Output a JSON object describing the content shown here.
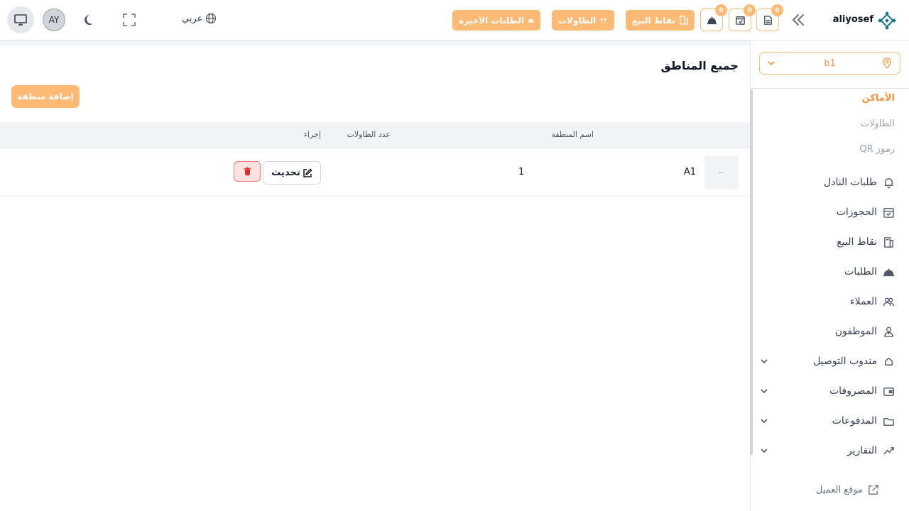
{
  "header": {
    "brand": "aliyosef",
    "badges": {
      "orders_count": "0",
      "reservations_count": "0",
      "waiter_count": "0"
    },
    "recent_orders_label": "الطلبات الأخيرة",
    "tables_label": "الطاولات",
    "pos_label": "نقاط البيع",
    "language_label": "عربي",
    "avatar_initials": "AY"
  },
  "sidebar": {
    "branch": "b1",
    "subitems": [
      "الأماكن",
      "الطاولات",
      "رموز QR"
    ],
    "items": [
      {
        "label": "طلبات النادل",
        "icon": "bell-icon",
        "expandable": false
      },
      {
        "label": "الحجوزات",
        "icon": "calendar-check-icon",
        "expandable": false
      },
      {
        "label": "نقاط البيع",
        "icon": "pos-icon",
        "expandable": false
      },
      {
        "label": "الطلبات",
        "icon": "cloche-icon",
        "expandable": false
      },
      {
        "label": "العملاء",
        "icon": "users-icon",
        "expandable": false
      },
      {
        "label": "الموظفون",
        "icon": "staff-icon",
        "expandable": false
      },
      {
        "label": "مندوب التوصيل",
        "icon": "delivery-icon",
        "expandable": true
      },
      {
        "label": "المصروفات",
        "icon": "wallet-icon",
        "expandable": true
      },
      {
        "label": "المدفوعات",
        "icon": "folder-icon",
        "expandable": true
      },
      {
        "label": "التقارير",
        "icon": "chart-icon",
        "expandable": true
      }
    ],
    "client_site": "موقع العميل"
  },
  "main": {
    "title": "جميع المناطق",
    "add_button": "إضافة منطقة",
    "columns": {
      "name": "اسم المنطقة",
      "tables_count": "عدد الطاولات",
      "action": "إجراء"
    },
    "rows": [
      {
        "thumb": "--",
        "name": "A1",
        "tables_count": "1",
        "update_label": "تحديث"
      }
    ]
  },
  "colors": {
    "accent": "#fdba74",
    "accent_text": "#fb923c",
    "danger": "#dc2626"
  }
}
